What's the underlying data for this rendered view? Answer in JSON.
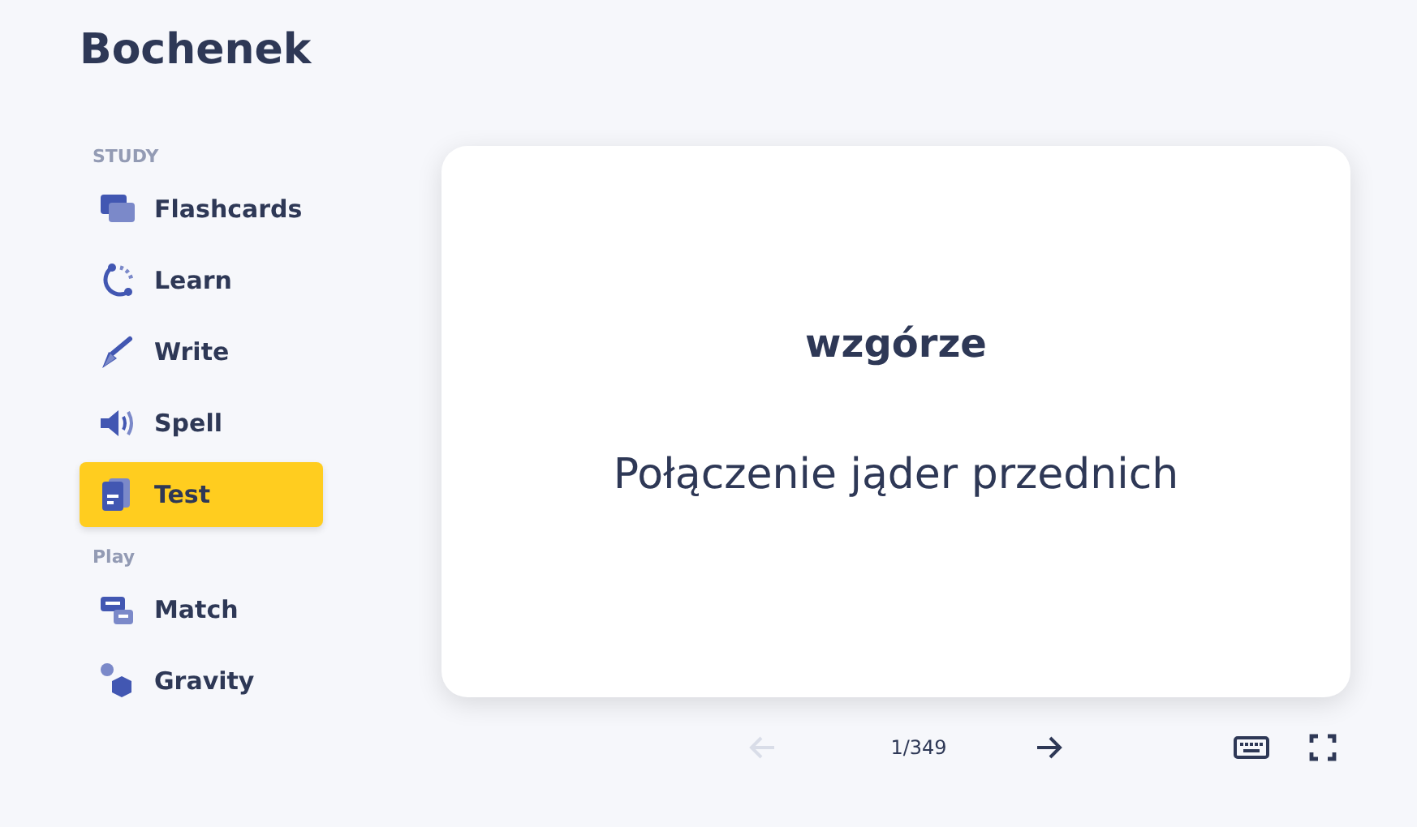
{
  "title": "Bochenek",
  "sidebar": {
    "sections": [
      {
        "label": "STUDY",
        "items": [
          {
            "label": "Flashcards",
            "kind": "flashcards",
            "selected": false
          },
          {
            "label": "Learn",
            "kind": "learn",
            "selected": false
          },
          {
            "label": "Write",
            "kind": "write",
            "selected": false
          },
          {
            "label": "Spell",
            "kind": "spell",
            "selected": false
          },
          {
            "label": "Test",
            "kind": "test",
            "selected": true
          }
        ]
      },
      {
        "label": "Play",
        "items": [
          {
            "label": "Match",
            "kind": "match",
            "selected": false
          },
          {
            "label": "Gravity",
            "kind": "gravity",
            "selected": false
          }
        ]
      }
    ]
  },
  "card": {
    "term": "wzgórze",
    "definition": "Połączenie jąder przednich"
  },
  "controls": {
    "previous": {
      "disabled": true
    },
    "next": {
      "disabled": false
    },
    "counter": "1/349"
  }
}
